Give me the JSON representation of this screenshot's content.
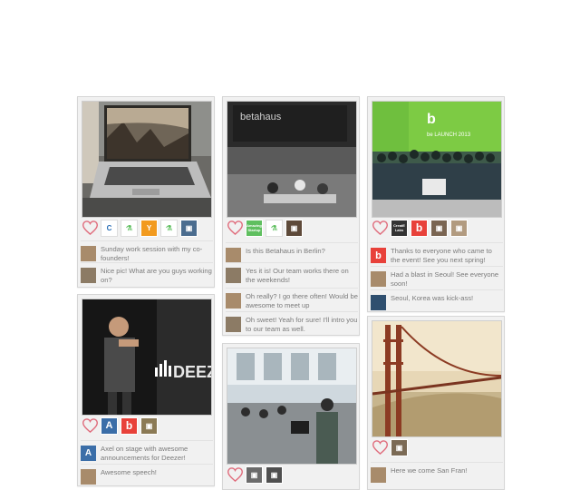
{
  "cards": [
    {
      "comments": [
        {
          "text": "Sunday work session with my co-founders!",
          "avatar": "avatar-man"
        },
        {
          "text": "Nice pic! What are you guys working on?",
          "avatar": "avatar-man"
        }
      ],
      "badges": [
        "C",
        "⚗",
        "Y",
        "⚗",
        "▣"
      ]
    },
    {
      "comments": [
        {
          "text": "Is this Betahaus in Berlin?",
          "avatar": "avatar-man"
        },
        {
          "text": "Yes it is! Our team works there on the weekends!",
          "avatar": "avatar-man"
        },
        {
          "text": "Oh really? I go there often! Would be awesome to meet up",
          "avatar": "avatar-man"
        },
        {
          "text": "Oh sweet! Yeah for sure! I'll intro you to our team as well.",
          "avatar": "avatar-man"
        }
      ],
      "badges": [
        "⚗",
        "▣"
      ],
      "badge_small_text": "Amazing Startup"
    },
    {
      "comments": [
        {
          "text": "Thanks to everyone who came to the event! See you next spring!",
          "avatar": "b"
        },
        {
          "text": "Had a blast in Seoul! See everyone soon!",
          "avatar": "avatar-man"
        },
        {
          "text": "Seoul, Korea was kick-ass!",
          "avatar": "avatar-man"
        }
      ],
      "badges": [
        "CreatE Labs",
        "b",
        "▣",
        "▣"
      ],
      "badge_creat_text": "CreatE Labs"
    },
    {
      "comments": [
        {
          "text": "Axel on stage with awesome announcements for Deezer!",
          "avatar": "A"
        },
        {
          "text": "Awesome speech!",
          "avatar": "avatar-man"
        }
      ],
      "badges": [
        "A",
        "b",
        "▣"
      ],
      "deezer_text": "DEEZ"
    },
    {
      "comments": [],
      "badges": [
        "▣",
        "▣"
      ]
    },
    {
      "comments": [
        {
          "text": "Here we come San Fran!",
          "avatar": "avatar-man"
        }
      ],
      "badges": [
        "▣"
      ]
    }
  ],
  "colors": {
    "heart": "#e06c7c",
    "b_red": "#e8413a",
    "blue": "#3b6ea8",
    "orange": "#f29a1e",
    "green": "#5fbf5f"
  }
}
